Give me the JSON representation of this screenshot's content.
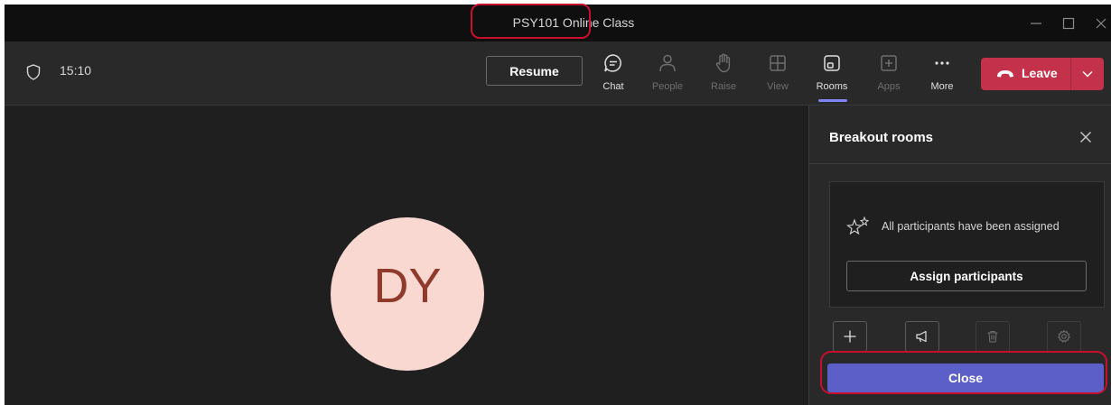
{
  "window": {
    "title": "PSY101 Online Class"
  },
  "toolbar": {
    "time": "15:10",
    "resume_label": "Resume",
    "tools": [
      {
        "label": "Chat",
        "icon": "chat-icon",
        "active": false,
        "enabled": true
      },
      {
        "label": "People",
        "icon": "people-icon",
        "active": false,
        "enabled": false
      },
      {
        "label": "Raise",
        "icon": "raise-hand-icon",
        "active": false,
        "enabled": false
      },
      {
        "label": "View",
        "icon": "view-grid-icon",
        "active": false,
        "enabled": false
      },
      {
        "label": "Rooms",
        "icon": "rooms-icon",
        "active": true,
        "enabled": true
      },
      {
        "label": "Apps",
        "icon": "apps-plus-icon",
        "active": false,
        "enabled": false
      },
      {
        "label": "More",
        "icon": "more-dots-icon",
        "active": false,
        "enabled": true
      }
    ],
    "leave_label": "Leave"
  },
  "stage": {
    "avatar_initials": "DY"
  },
  "panel": {
    "title": "Breakout rooms",
    "assigned_message": "All participants have been assigned",
    "assign_button": "Assign participants",
    "actions": [
      {
        "icon": "add-icon",
        "enabled": true
      },
      {
        "icon": "announce-icon",
        "enabled": true
      },
      {
        "icon": "delete-icon",
        "enabled": false
      },
      {
        "icon": "settings-gear-icon",
        "enabled": false
      }
    ],
    "close_button": "Close"
  },
  "colors": {
    "accent": "#5b5fc7",
    "leave": "#c4314b",
    "annotation": "#c8102e",
    "avatar_bg": "#f9d8d2",
    "avatar_text": "#8f3a2b"
  }
}
